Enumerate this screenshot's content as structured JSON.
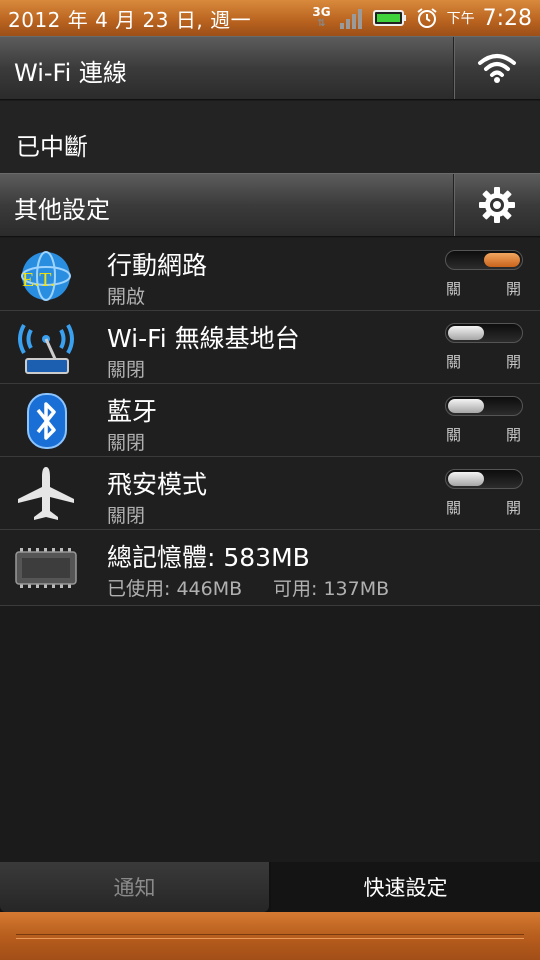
{
  "status_bar": {
    "date": "2012 年 4 月 23 日, 週一",
    "network": "3G",
    "ampm": "下午",
    "time": "7:28"
  },
  "wifi_section": {
    "title": "Wi-Fi 連線",
    "status": "已中斷",
    "icon": "wifi-icon"
  },
  "other_section": {
    "title": "其他設定",
    "icon": "gear-icon"
  },
  "settings": [
    {
      "name": "行動網路",
      "status": "開啟",
      "toggle_state": "on",
      "off_label": "關",
      "on_label": "開",
      "icon": "et-globe-icon",
      "icon_text": "E.T."
    },
    {
      "name": "Wi-Fi 無線基地台",
      "status": "關閉",
      "toggle_state": "off",
      "off_label": "關",
      "on_label": "開",
      "icon": "hotspot-icon"
    },
    {
      "name": "藍牙",
      "status": "關閉",
      "toggle_state": "off",
      "off_label": "關",
      "on_label": "開",
      "icon": "bluetooth-icon"
    },
    {
      "name": "飛安模式",
      "status": "關閉",
      "toggle_state": "off",
      "off_label": "關",
      "on_label": "開",
      "icon": "airplane-icon"
    }
  ],
  "memory": {
    "title": "總記憶體: 583MB",
    "used": "已使用: 446MB",
    "free": "可用: 137MB",
    "icon": "memory-chip-icon"
  },
  "tabs": [
    {
      "label": "通知",
      "active": false
    },
    {
      "label": "快速設定",
      "active": true
    }
  ],
  "colors": {
    "accent": "#c8681f",
    "toggle_on": "#e07f35"
  }
}
